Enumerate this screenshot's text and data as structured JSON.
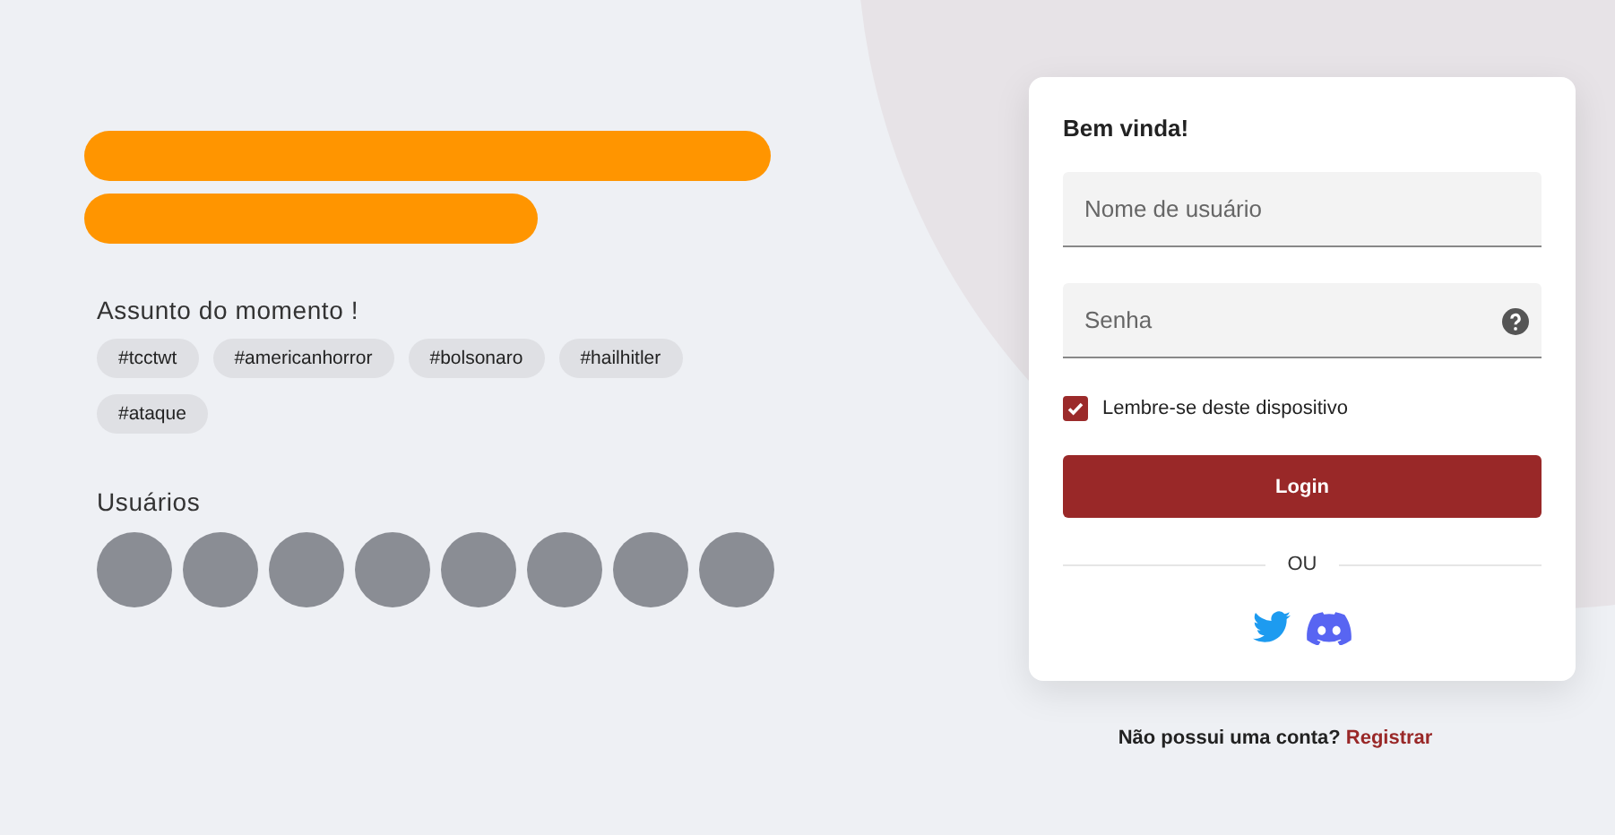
{
  "hero": {
    "redaction_bars": [
      {
        "kind": "long"
      },
      {
        "kind": "short"
      }
    ]
  },
  "trending": {
    "title": "Assunto do momento !",
    "tags": [
      "#tcctwt",
      "#americanhorror",
      "#bolsonaro",
      "#hailhitler",
      "#ataque"
    ]
  },
  "users": {
    "title": "Usuários",
    "avatars": [
      {
        "kind": "photo"
      },
      {
        "kind": "photo"
      },
      {
        "kind": "photo"
      },
      {
        "kind": "photo"
      },
      {
        "kind": "photo"
      },
      {
        "kind": "photo"
      },
      {
        "kind": "photo"
      },
      {
        "kind": "photo"
      }
    ]
  },
  "login": {
    "title": "Bem vinda!",
    "username": {
      "placeholder": "Nome de usuário"
    },
    "password": {
      "placeholder": "Senha"
    },
    "remember": {
      "label": "Lembre-se deste dispositivo",
      "checked": true
    },
    "button": "Login",
    "divider": "OU"
  },
  "signup": {
    "question": "Não possui uma conta?",
    "link": "Registrar"
  }
}
